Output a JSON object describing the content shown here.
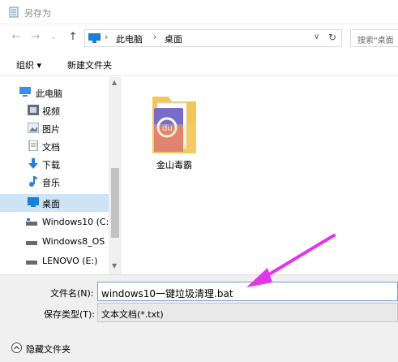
{
  "window": {
    "title": "另存为"
  },
  "nav": {
    "back_icon": "arrow-left-icon",
    "forward_icon": "arrow-right-icon",
    "recent_icon": "chevron-down-icon",
    "up_icon": "arrow-up-icon",
    "address": {
      "segments": [
        "此电脑",
        "桌面"
      ],
      "separator": "›"
    },
    "search_placeholder": "搜索\"桌面"
  },
  "toolbar": {
    "organize_label": "组织 ▾",
    "new_folder_label": "新建文件夹"
  },
  "sidebar": {
    "items": [
      {
        "label": "此电脑",
        "icon": "computer-icon"
      },
      {
        "label": "视频",
        "icon": "video-icon"
      },
      {
        "label": "图片",
        "icon": "pictures-icon"
      },
      {
        "label": "文档",
        "icon": "documents-icon"
      },
      {
        "label": "下载",
        "icon": "download-icon"
      },
      {
        "label": "音乐",
        "icon": "music-icon"
      },
      {
        "label": "桌面",
        "icon": "desktop-icon",
        "selected": true
      },
      {
        "label": "Windows10 (C:",
        "icon": "drive-icon"
      },
      {
        "label": "Windows8_OS",
        "icon": "drive-icon"
      },
      {
        "label": "LENOVO (E:)",
        "icon": "drive-icon"
      }
    ]
  },
  "content": {
    "items": [
      {
        "label": "金山毒霸",
        "icon": "folder-icon"
      }
    ]
  },
  "form": {
    "filename_label": "文件名(N):",
    "filename_value": "windows10一键垃圾清理.bat",
    "type_label": "保存类型(T):",
    "type_value": "文本文档(*.txt)"
  },
  "footer": {
    "hide_folders_label": "隐藏文件夹"
  },
  "colors": {
    "selection": "#cce4f7",
    "annotation_arrow": "#e234e8",
    "folder": "#f3c659"
  }
}
